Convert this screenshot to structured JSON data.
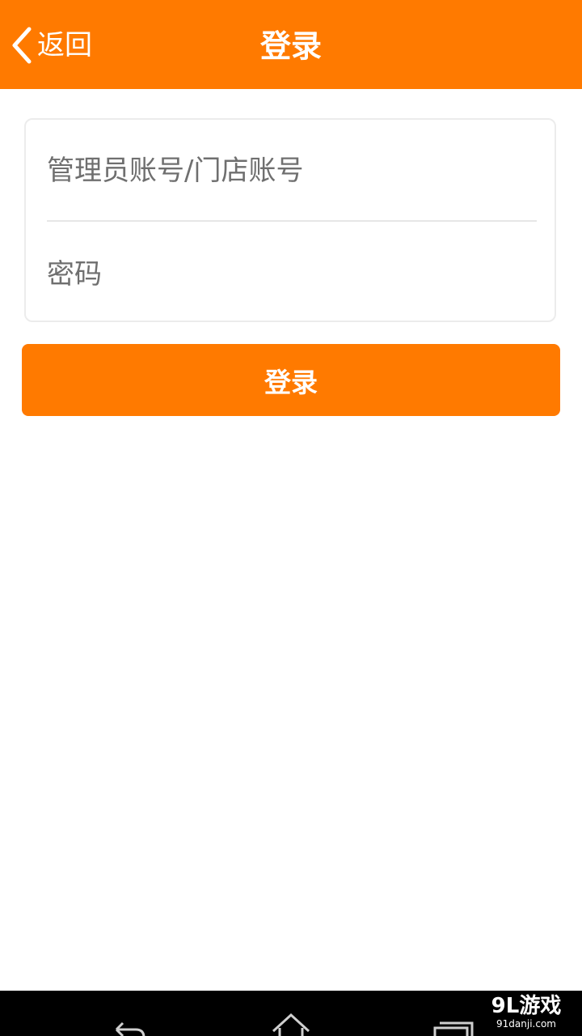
{
  "header": {
    "back_label": "返回",
    "title": "登录",
    "background_color": "#FF7A00"
  },
  "form": {
    "account_placeholder": "管理员账号/门店账号",
    "account_value": "",
    "password_placeholder": "密码",
    "password_value": ""
  },
  "login_button": {
    "label": "登录",
    "color": "#FF7A00"
  },
  "navbar": {
    "icons": [
      "back-icon",
      "home-icon",
      "recent-apps-icon"
    ]
  },
  "watermark": {
    "main": "9L游戏",
    "sub": "91danji.com"
  }
}
